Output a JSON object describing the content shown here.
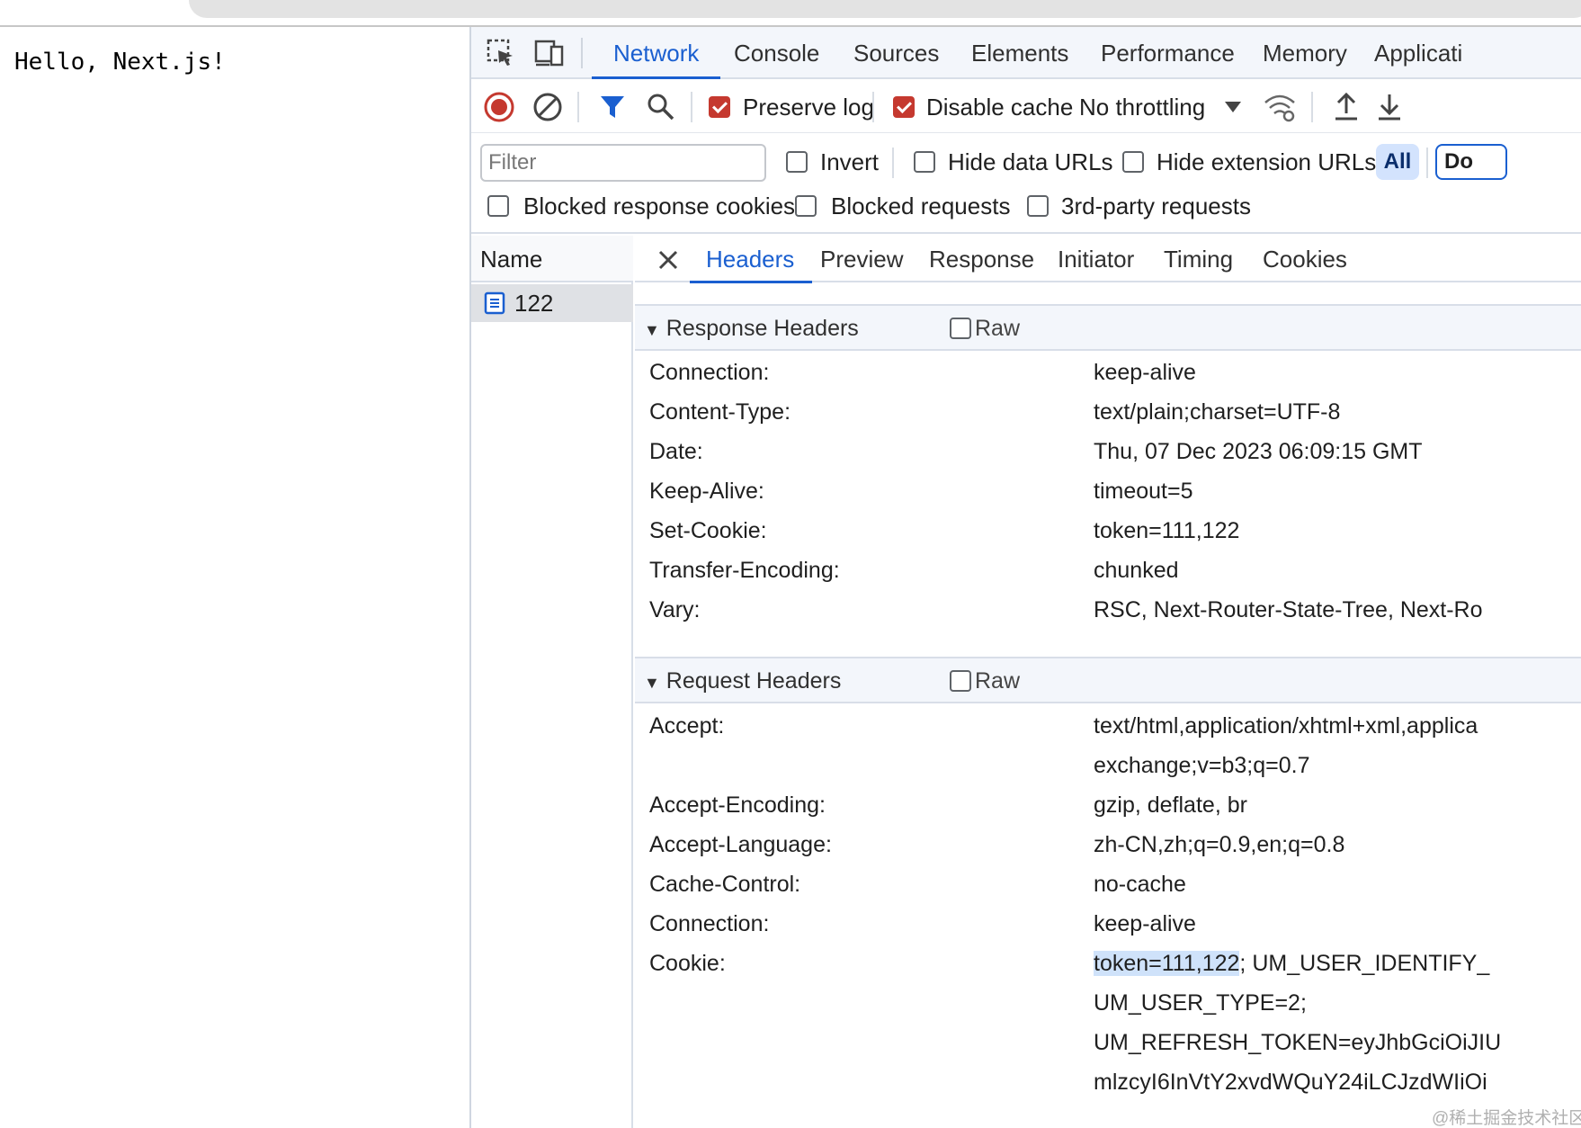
{
  "page": {
    "content": "Hello, Next.js!"
  },
  "devtools": {
    "main_tabs": [
      "Network",
      "Console",
      "Sources",
      "Elements",
      "Performance",
      "Memory",
      "Applicati"
    ],
    "toolbar": {
      "preserve_log": "Preserve log",
      "disable_cache": "Disable cache",
      "throttling": "No throttling"
    },
    "filter": {
      "placeholder": "Filter",
      "invert": "Invert",
      "hide_data_urls": "Hide data URLs",
      "hide_extension_urls": "Hide extension URLs",
      "all": "All",
      "doc": "Do",
      "blocked_response_cookies": "Blocked response cookies",
      "blocked_requests": "Blocked requests",
      "third_party": "3rd-party requests"
    },
    "requests": {
      "header": "Name",
      "items": [
        "122"
      ]
    },
    "detail_tabs": [
      "Headers",
      "Preview",
      "Response",
      "Initiator",
      "Timing",
      "Cookies"
    ],
    "response_headers": {
      "title": "Response Headers",
      "raw": "Raw",
      "rows": [
        {
          "key": "Connection:",
          "value": "keep-alive"
        },
        {
          "key": "Content-Type:",
          "value": "text/plain;charset=UTF-8"
        },
        {
          "key": "Date:",
          "value": "Thu, 07 Dec 2023 06:09:15 GMT"
        },
        {
          "key": "Keep-Alive:",
          "value": "timeout=5"
        },
        {
          "key": "Set-Cookie:",
          "value": "token=111,122"
        },
        {
          "key": "Transfer-Encoding:",
          "value": "chunked"
        },
        {
          "key": "Vary:",
          "value": "RSC, Next-Router-State-Tree, Next-Ro"
        }
      ]
    },
    "request_headers": {
      "title": "Request Headers",
      "raw": "Raw",
      "accept_key": "Accept:",
      "accept_value_1": "text/html,application/xhtml+xml,applica",
      "accept_value_2": "exchange;v=b3;q=0.7",
      "rows": [
        {
          "key": "Accept-Encoding:",
          "value": "gzip, deflate, br"
        },
        {
          "key": "Accept-Language:",
          "value": "zh-CN,zh;q=0.9,en;q=0.8"
        },
        {
          "key": "Cache-Control:",
          "value": "no-cache"
        },
        {
          "key": "Connection:",
          "value": "keep-alive"
        }
      ],
      "cookie_key": "Cookie:",
      "cookie_highlight": "token=111,122",
      "cookie_rest": "; UM_USER_IDENTIFY_",
      "cookie_line_2": "UM_USER_TYPE=2;",
      "cookie_line_3": "UM_REFRESH_TOKEN=eyJhbGciOiJIU",
      "cookie_line_4": "mlzcyI6InVtY2xvdWQuY24iLCJzdWIiOi"
    }
  },
  "watermark": "@稀土掘金技术社区",
  "colors": {
    "accent": "#1a5fd0",
    "record": "#c5392f",
    "checkbox_on": "#c5392f",
    "highlight": "#cfe2fa"
  }
}
